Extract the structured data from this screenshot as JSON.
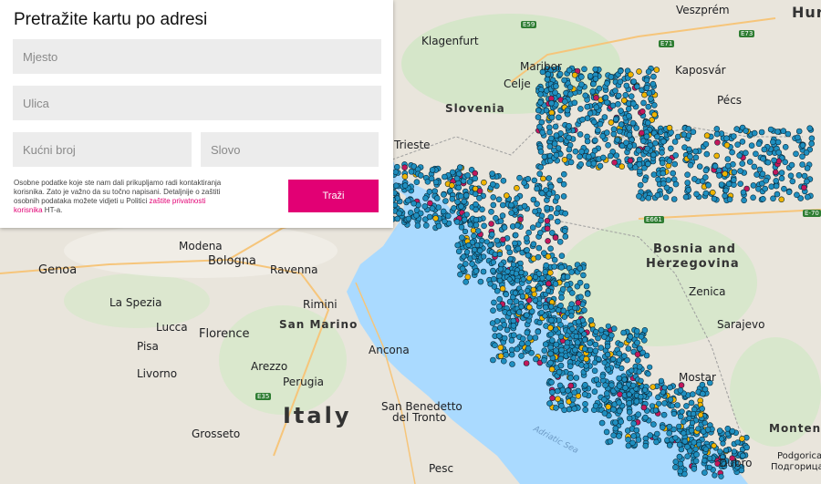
{
  "form": {
    "title": "Pretražite kartu po adresi",
    "place_placeholder": "Mjesto",
    "street_placeholder": "Ulica",
    "house_number_placeholder": "Kućni broj",
    "letter_placeholder": "Slovo",
    "privacy_note": "Osobne podatke koje ste nam dali prikupljamo radi kontaktiranja korisnika. Zato je važno da su točno napisani. Detaljnije o zaštiti osobnih podataka možete vidjeti u Politici",
    "privacy_link": "zaštite privatnosti korisnika",
    "privacy_suffix": " HT-a.",
    "search_button": "Traži"
  },
  "map": {
    "countries": {
      "slovenia": "Slovenia",
      "bosnia_line1": "Bosnia and",
      "bosnia_line2": "Herzegovina",
      "italy": "Italy",
      "san_marino": "San Marino",
      "montenegro": "Montene",
      "hungary": "Hur"
    },
    "cities": {
      "klagenfurt": "Klagenfurt",
      "maribor": "Maribor",
      "celje": "Celje",
      "veszprem": "Veszprém",
      "kaposvar": "Kaposvár",
      "pecs": "Pécs",
      "trieste": "Trieste",
      "genoa": "Genoa",
      "bologna": "Bologna",
      "modena": "Modena",
      "ravenna": "Ravenna",
      "rimini": "Rimini",
      "la_spezia": "La Spezia",
      "lucca": "Lucca",
      "florence": "Florence",
      "pisa": "Pisa",
      "livorno": "Livorno",
      "arezzo": "Arezzo",
      "ancona": "Ancona",
      "perugia": "Perugia",
      "grosseto": "Grosseto",
      "san_benedetto": "San Benedetto",
      "del_tronto": "del Tronto",
      "sarajevo": "Sarajevo",
      "zenica": "Zenica",
      "mostar": "Mostar",
      "dubrovnik": "Dubro",
      "podgorica": "Podgorica",
      "podgorica2": "Подгорица",
      "pescara": "Pesc"
    },
    "sea": "Adriatic Sea",
    "roads": {
      "e59": "E59",
      "e71": "E71",
      "e73": "E73",
      "e661": "E661",
      "e35": "E35",
      "e70": "E-70"
    },
    "marker_colors": {
      "main": "#1f8fc0",
      "outline": "#0a2a3a",
      "highlight": "#c2185b",
      "secondary": "#f0b400"
    }
  }
}
